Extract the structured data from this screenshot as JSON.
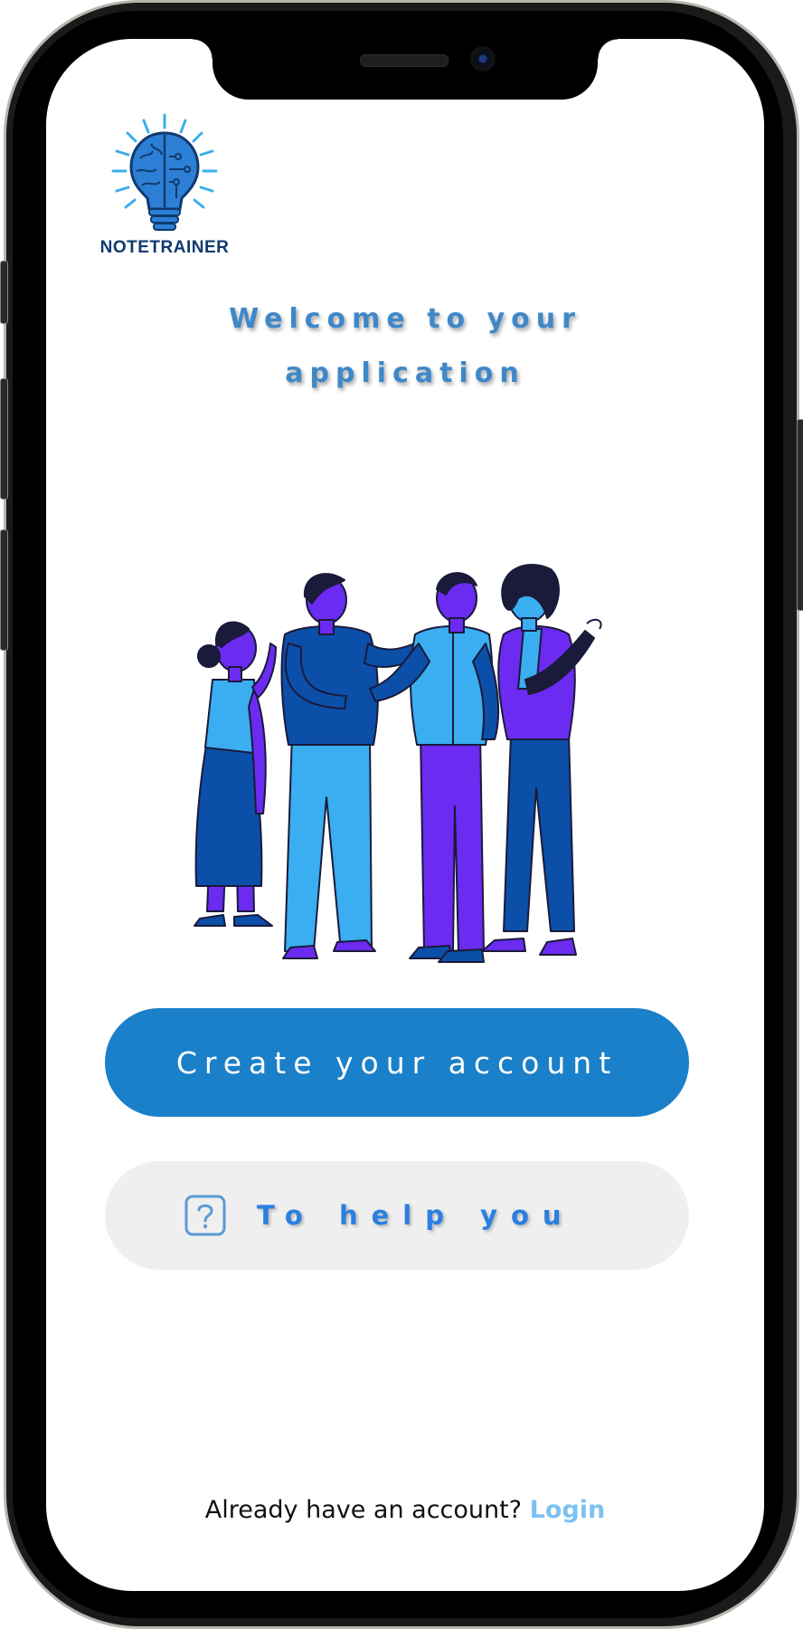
{
  "app": {
    "logo_text": "NOTETRAINER",
    "welcome_line1": "Welcome to your",
    "welcome_line2": "application"
  },
  "actions": {
    "create_account_label": "Create your account",
    "help_label": "To help you",
    "help_icon": "question-square-icon"
  },
  "footer": {
    "prompt": "Already have an account?",
    "login_label": "Login"
  },
  "colors": {
    "primary": "#1a80c9",
    "help_text": "#2a7fe0",
    "login_link": "#7ec1f0",
    "help_bg": "#efefef",
    "welcome_text": "#3e88c8"
  }
}
